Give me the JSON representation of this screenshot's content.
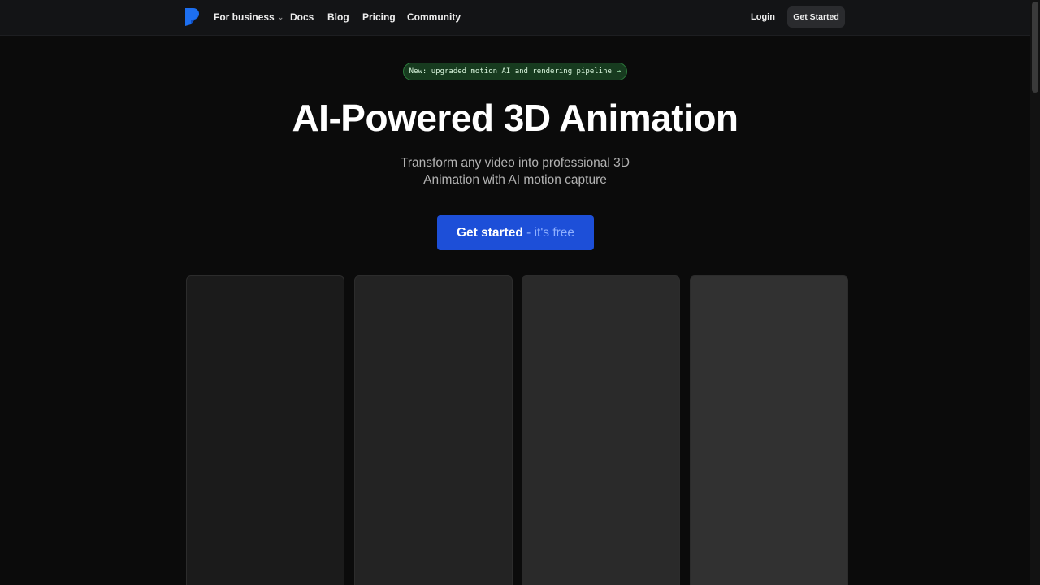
{
  "nav": {
    "items": [
      {
        "label": "For business",
        "has_dropdown": true
      },
      {
        "label": "Docs"
      },
      {
        "label": "Blog"
      },
      {
        "label": "Pricing"
      },
      {
        "label": "Community"
      }
    ],
    "login_label": "Login",
    "cta_label": "Get Started"
  },
  "hero": {
    "announcement": "New: upgraded motion AI and rendering pipeline",
    "announcement_arrow": "→",
    "title": "AI-Powered 3D Animation",
    "subtitle_line1": "Transform any video into professional 3D",
    "subtitle_line2": "Animation with AI motion capture",
    "cta_main": "Get started",
    "cta_suffix": " - it's free"
  },
  "colors": {
    "accent": "#1d4fd8",
    "badge_bg": "#173b1f",
    "badge_border": "#2b7a3b",
    "background": "#0b0b0b"
  },
  "icons": {
    "logo": "brand-logo-icon",
    "dropdown": "chevron-down-icon",
    "arrow": "arrow-right-icon"
  }
}
